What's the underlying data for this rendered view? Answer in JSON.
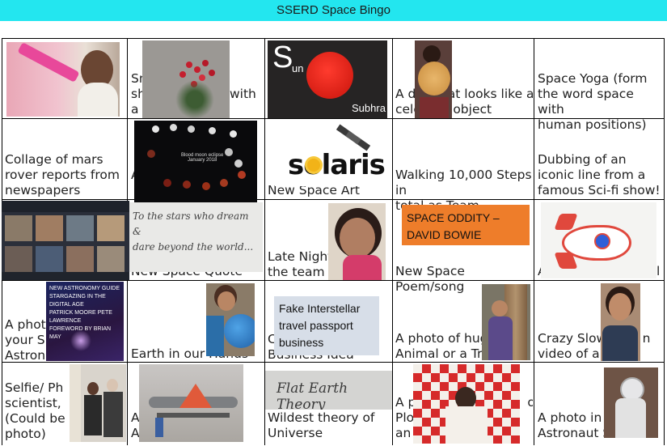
{
  "title": "SSERD Space Bingo",
  "cells": {
    "r1c2": "Sn\nsh\na",
    "r1c2_tail": "with",
    "r1c3_letter": "S",
    "r1c3_sub": "un",
    "r1c3_name": "Subhra",
    "r1c4": "A d        at looks like a\ncele        object",
    "r1c5": "Space Yoga (form\nthe word space with\nhuman positions)",
    "r2c1": "Collage of mars\nrover reports from\nnewspapers",
    "r2c2_edge": "A",
    "r2c2_img_title": "Blood moon eclipse\nJanuary 2018",
    "r2c3": "New Space Art",
    "r2c3_logo": "solaris",
    "r2c4": "Walking 10,000 Steps in\ntotal as Team",
    "r2c5": "Dubbing of an\niconic line from a\nfamous Sci-fi show!",
    "r3c2": "New Space Quote",
    "r3c2_handwriting": "To the stars who dream\n&\ndare beyond the world...",
    "r3c3": "Late Night\nthe team",
    "r3c4_badge": "SPACE ODDITY –\nDAVID BOWIE",
    "r3c4": "New Space Poem/song",
    "r3c5_edge": "A",
    "r3c5_tail": "l",
    "r4c1": "A photo\nyour Sp\nAstrono",
    "r4c1_book": "NEW ASTRONOMY GUIDE\nSTARGAZING IN THE DIGITAL AGE\nPATRICK MOORE   PETE LAWRENCE\nFOREWORD BY BRIAN MAY",
    "r4c2": "Earth in our Hands",
    "r4c3_edge": "C\nBusiness Idea",
    "r4c3_box": "Fake Interstellar\ntravel passport\nbusiness",
    "r4c4": "A photo of hug\nAnimal or a Tre",
    "r4c5": "Crazy Slow         n\nvideo of an",
    "r5c1": "Selfie/ Ph\nscientist,\n(Could be\nphoto)",
    "r5c2": "A                                    an\nA",
    "r5c3": "Wildest theory of\nUniverse",
    "r5c3_handwriting": "Flat Earth Theory",
    "r5c4": "A p                            or\nPlo\nan",
    "r5c5": "A photo in\nAstronaut S"
  },
  "colors": {
    "title_bar": "#23e6ef",
    "badge": "#ee7d2a",
    "passport_box": "#d7dee8"
  }
}
